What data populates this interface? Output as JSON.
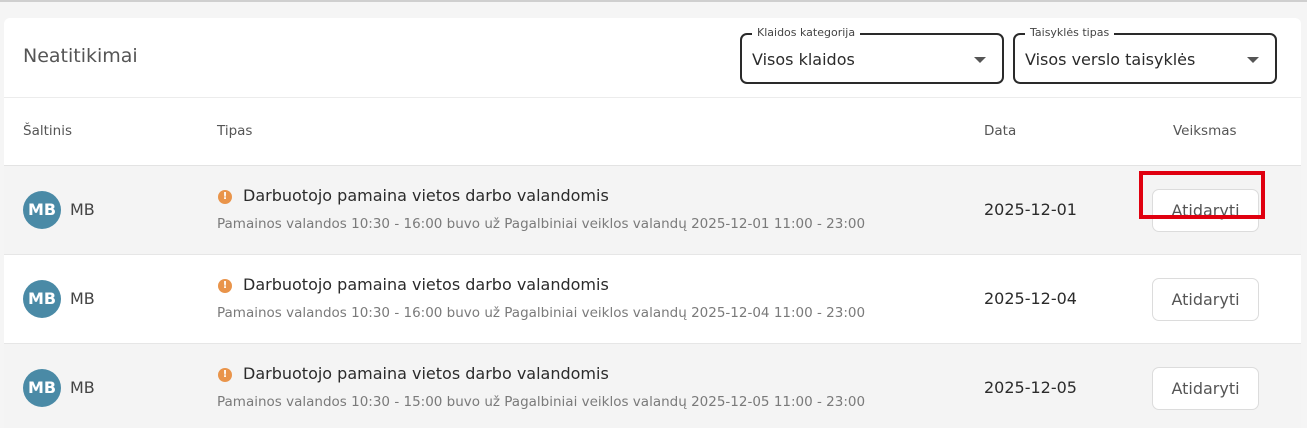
{
  "header": {
    "title": "Neatitikimai",
    "filters": [
      {
        "label": "Klaidos kategorija",
        "value": "Visos klaidos"
      },
      {
        "label": "Taisyklės tipas",
        "value": "Visos verslo taisyklės"
      }
    ]
  },
  "table": {
    "columns": {
      "source": "Šaltinis",
      "type": "Tipas",
      "date": "Data",
      "action": "Veiksmas"
    },
    "rows": [
      {
        "avatar": "MB",
        "source": "MB",
        "title": "Darbuotojo pamaina vietos darbo valandomis",
        "description": "Pamainos valandos 10:30 - 16:00 buvo už Pagalbiniai veiklos valandų 2025-12-01 11:00 - 23:00",
        "date": "2025-12-01",
        "action": "Atidaryti"
      },
      {
        "avatar": "MB",
        "source": "MB",
        "title": "Darbuotojo pamaina vietos darbo valandomis",
        "description": "Pamainos valandos 10:30 - 16:00 buvo už Pagalbiniai veiklos valandų 2025-12-04 11:00 - 23:00",
        "date": "2025-12-04",
        "action": "Atidaryti"
      },
      {
        "avatar": "MB",
        "source": "MB",
        "title": "Darbuotojo pamaina vietos darbo valandomis",
        "description": "Pamainos valandos 10:30 - 15:00 buvo už Pagalbiniai veiklos valandų 2025-12-05 11:00 - 23:00",
        "date": "2025-12-05",
        "action": "Atidaryti"
      }
    ]
  },
  "icons": {
    "warning": "warning-icon",
    "dropdown": "chevron-down-icon"
  },
  "colors": {
    "avatar": "#4a8aa6",
    "warning": "#e9944a",
    "highlight": "#e0000f"
  }
}
